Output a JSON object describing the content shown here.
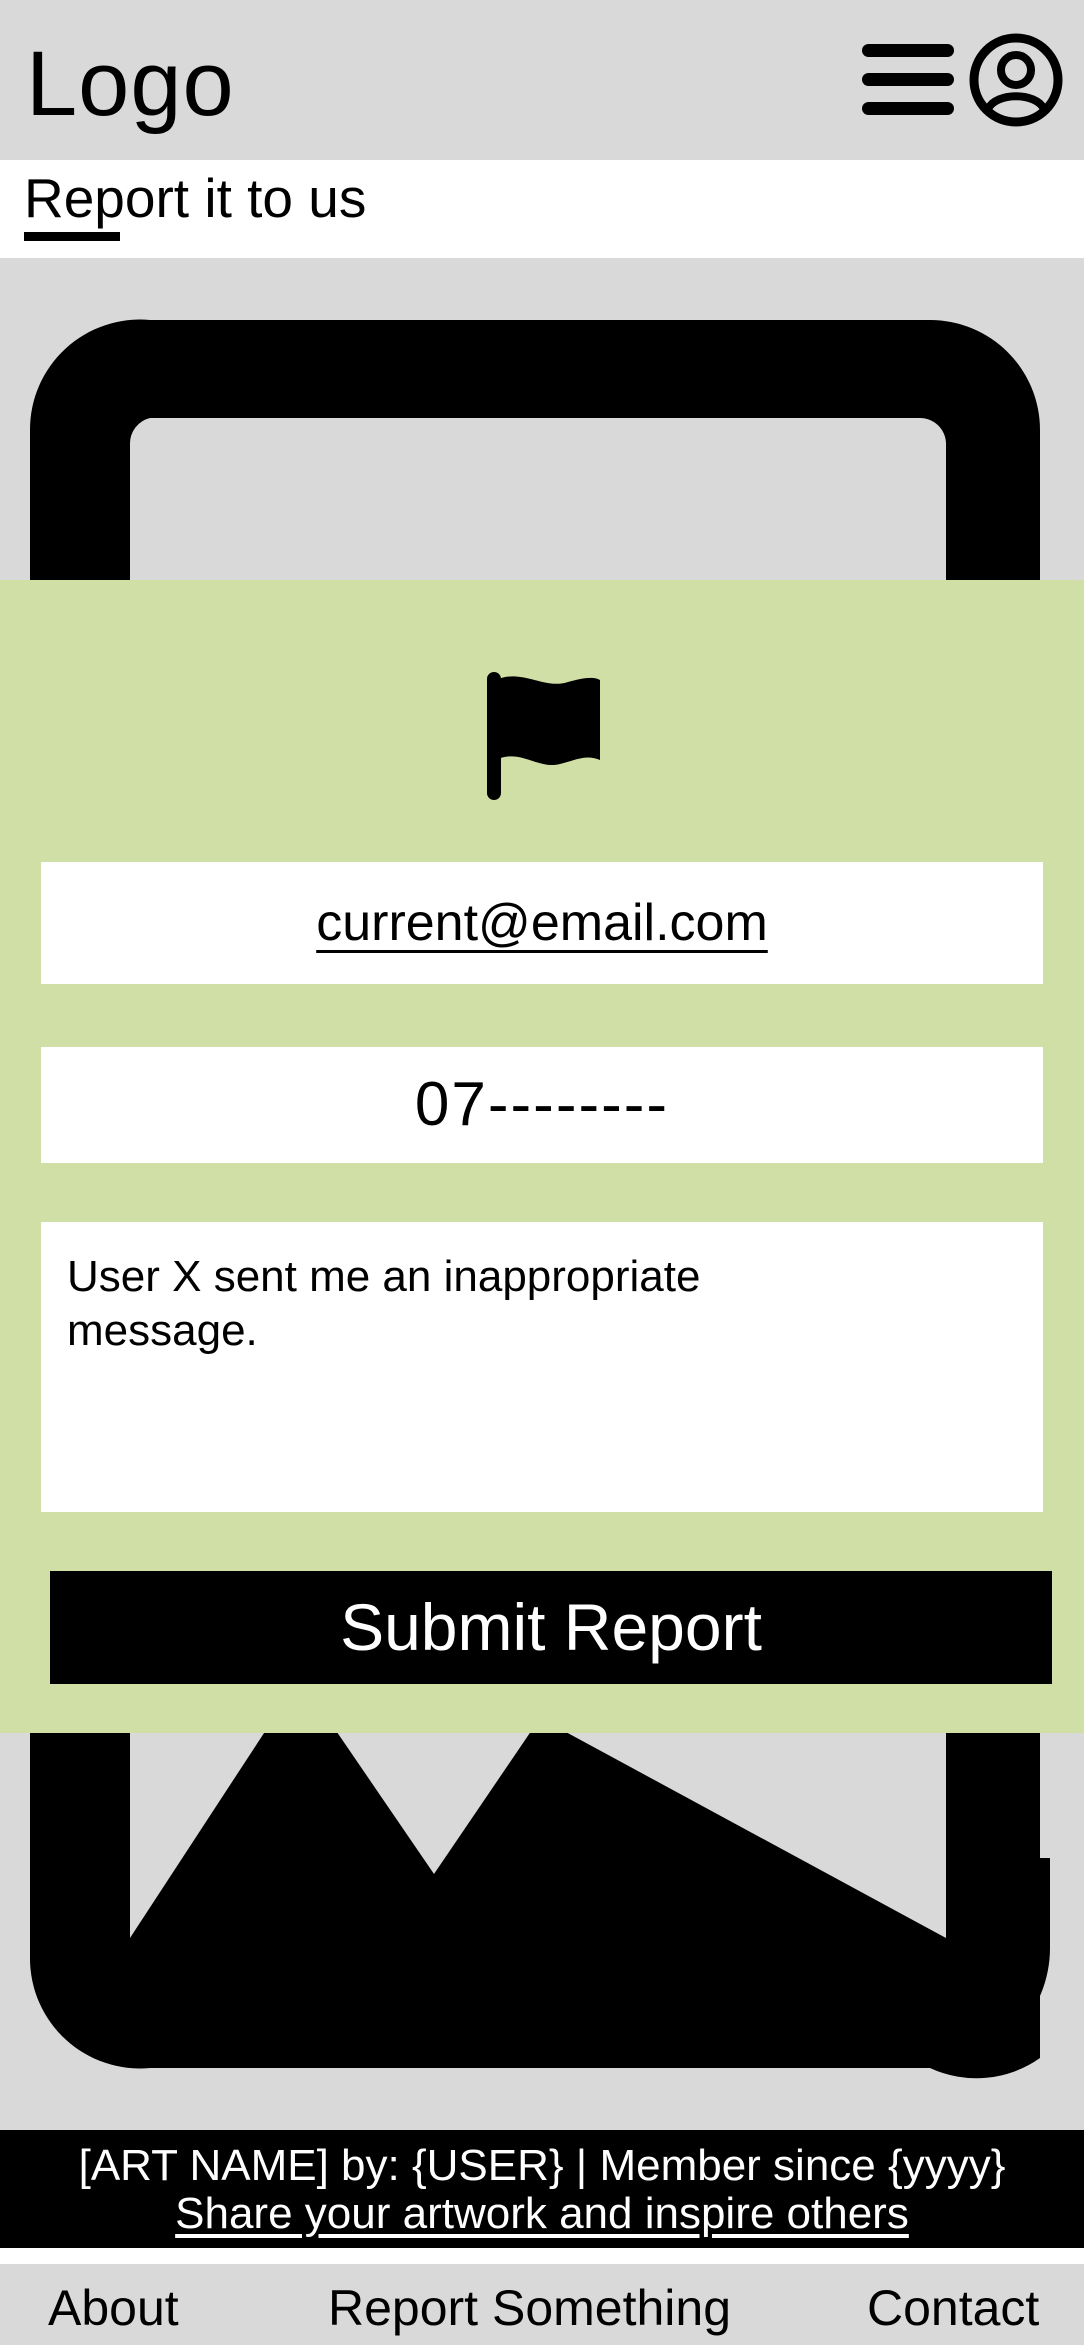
{
  "header": {
    "logo": "Logo",
    "menu_icon": "hamburger-menu-icon",
    "account_icon": "user-account-icon"
  },
  "page": {
    "subtitle": "Report it to us"
  },
  "artwork": {
    "placeholder_icon": "image-placeholder-icon"
  },
  "report_form": {
    "flag_icon": "flag-icon",
    "email_value": "current@email.com",
    "phone_value": "07--------",
    "message_value": "User X sent me an inappropriate\nmessage.",
    "submit_label": "Submit Report",
    "panel_color": "#cfdfa5"
  },
  "footer": {
    "credit": "[ART NAME] by: {USER} | Member since {yyyy}",
    "share_link": "Share your artwork and inspire others"
  },
  "bottom_nav": {
    "about": "About",
    "report": "Report Something",
    "contact": "Contact"
  },
  "colors": {
    "background_grey": "#d9d9d9",
    "accent_green": "#cfdfa5",
    "black": "#000000"
  }
}
